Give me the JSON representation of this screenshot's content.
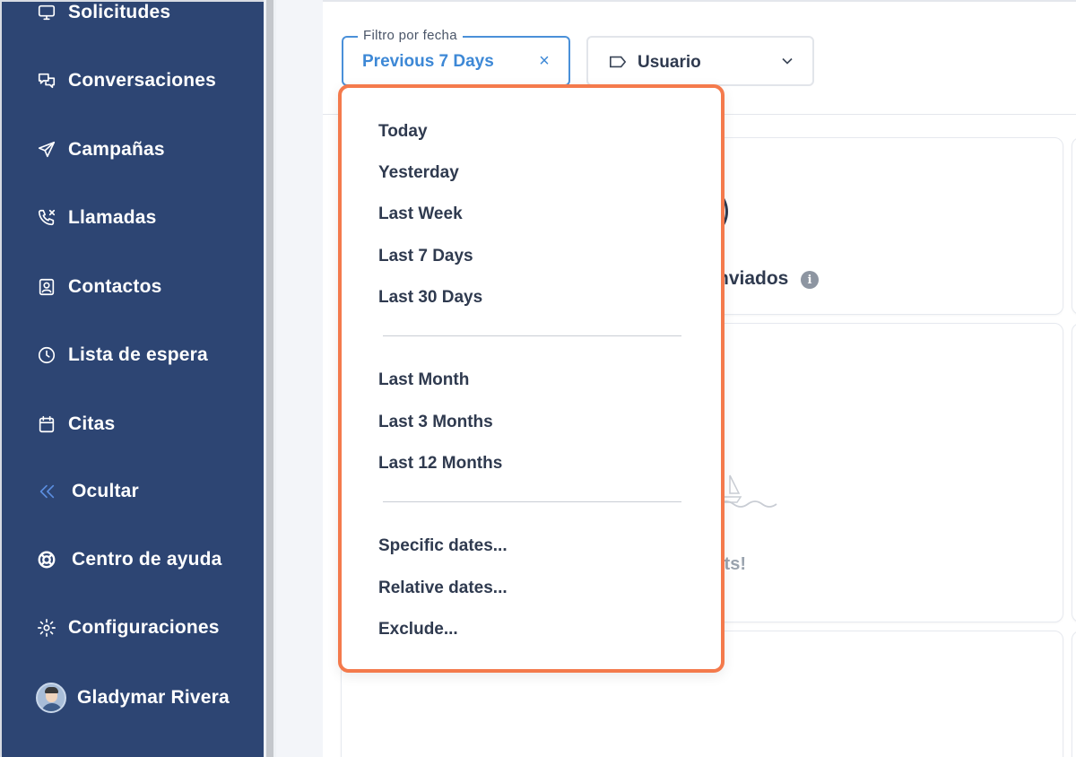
{
  "sidebar": {
    "items": [
      {
        "label": "Solicitudes",
        "icon": "monitor-icon"
      },
      {
        "label": "Conversaciones",
        "icon": "chat-bubbles-icon"
      },
      {
        "label": "Campañas",
        "icon": "paper-plane-icon"
      },
      {
        "label": "Llamadas",
        "icon": "phone-missed-icon"
      },
      {
        "label": "Contactos",
        "icon": "contact-card-icon"
      },
      {
        "label": "Lista de espera",
        "icon": "clock-icon"
      },
      {
        "label": "Citas",
        "icon": "calendar-icon"
      },
      {
        "label": "Ocultar",
        "icon": "double-chevron-left-icon"
      },
      {
        "label": "Centro de ayuda",
        "icon": "lifebuoy-icon"
      },
      {
        "label": "Configuraciones",
        "icon": "gear-icon"
      }
    ],
    "user": {
      "name": "Gladymar Rivera"
    }
  },
  "filters": {
    "date": {
      "legend": "Filtro por fecha",
      "value": "Previous 7 Days",
      "clear": "×"
    },
    "user": {
      "label": "Usuario"
    }
  },
  "dropdown": {
    "group1": [
      "Today",
      "Yesterday",
      "Last Week",
      "Last 7 Days",
      "Last 30 Days"
    ],
    "group2": [
      "Last Month",
      "Last 3 Months",
      "Last 12 Months"
    ],
    "group3": [
      "Specific dates...",
      "Relative dates...",
      "Exclude..."
    ]
  },
  "cards": {
    "sent_label_fragment": "nviados",
    "info": "i",
    "empty_fragment": "lts!"
  },
  "colors": {
    "sidebar_bg": "#2d4573",
    "accent_blue": "#3d88d6",
    "highlight_orange": "#f47a4c"
  }
}
